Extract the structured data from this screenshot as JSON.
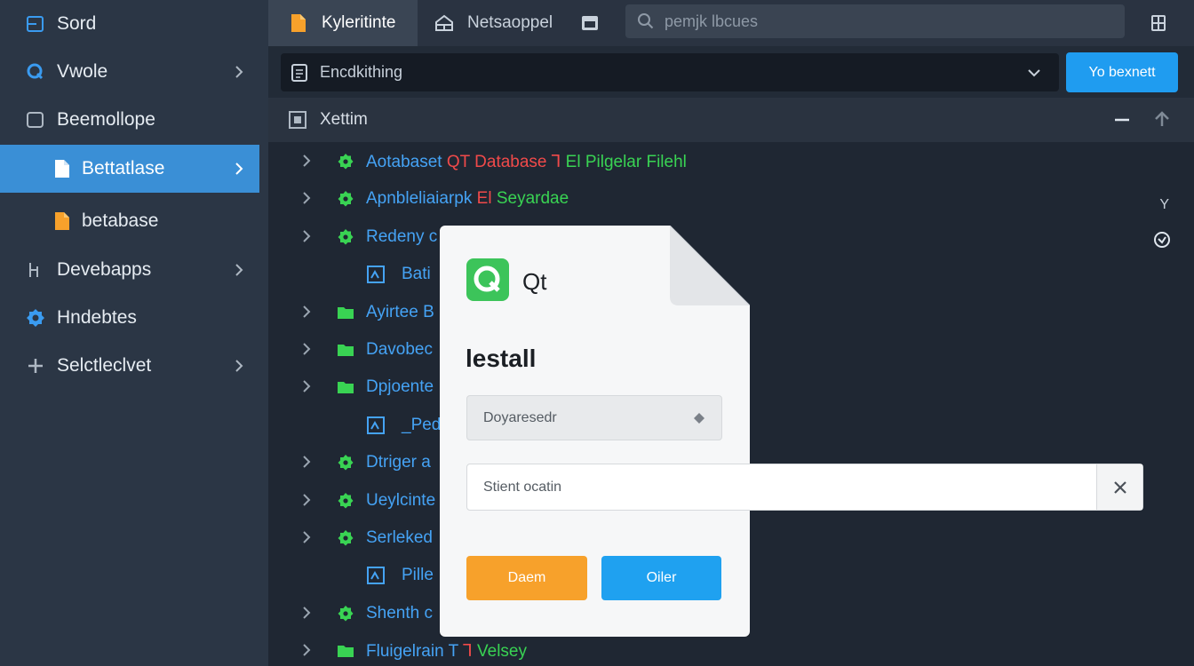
{
  "sidebar": {
    "items": [
      {
        "label": "Sord",
        "icon": "folder-outline-icon"
      },
      {
        "label": "Vwole",
        "icon": "q-icon"
      },
      {
        "label": "Beemollope",
        "icon": "square-outline-icon"
      },
      {
        "label": "Bettatlase",
        "icon": "file-icon"
      },
      {
        "label": "betabase",
        "icon": "orange-file-icon"
      },
      {
        "label": "Devebapps",
        "icon": "h-icon"
      },
      {
        "label": "Hndebtes",
        "icon": "gear-icon"
      },
      {
        "label": "Selctleclvet",
        "icon": "plus-icon"
      }
    ]
  },
  "topbar": {
    "tabs": [
      {
        "label": "Kyleritinte",
        "icon": "orange-file-icon"
      },
      {
        "label": "Netsaoppel",
        "icon": "home-icon"
      }
    ],
    "search_placeholder": "pemjk lbcues"
  },
  "pathbar": {
    "value": "Encdkithing",
    "button_label": "Yo bexnett"
  },
  "section": {
    "label": "Xettim"
  },
  "tree": {
    "rows": [
      {
        "parts": [
          {
            "t": "Aotabaset ",
            "c": "blue"
          },
          {
            "t": "QT Database ⅂ ",
            "c": "red"
          },
          {
            "t": "El Pilgelar Filehl",
            "c": "green"
          }
        ],
        "icon": "green-gear-icon",
        "leaf": false
      },
      {
        "parts": [
          {
            "t": "Apnbleliaiarpk ",
            "c": "blue"
          },
          {
            "t": "El ",
            "c": "red"
          },
          {
            "t": "Seyardae",
            "c": "green"
          }
        ],
        "icon": "green-gear-icon",
        "leaf": false
      },
      {
        "parts": [
          {
            "t": "Redeny c",
            "c": "blue"
          }
        ],
        "icon": "green-gear-icon",
        "leaf": false
      },
      {
        "parts": [
          {
            "t": "Bati",
            "c": "blue"
          }
        ],
        "icon": "blue-box-icon",
        "leaf": true
      },
      {
        "parts": [
          {
            "t": "Ayirtee B",
            "c": "blue"
          }
        ],
        "icon": "green-folder-icon",
        "leaf": false
      },
      {
        "parts": [
          {
            "t": "Davobec",
            "c": "blue"
          }
        ],
        "icon": "green-folder-icon",
        "leaf": false
      },
      {
        "parts": [
          {
            "t": "Dpjoente",
            "c": "blue"
          }
        ],
        "icon": "green-folder-icon",
        "leaf": false
      },
      {
        "parts": [
          {
            "t": "_Pedi",
            "c": "blue"
          }
        ],
        "icon": "blue-box-icon",
        "leaf": true
      },
      {
        "parts": [
          {
            "t": "Dtriger a",
            "c": "blue"
          }
        ],
        "icon": "green-gear-icon",
        "leaf": false
      },
      {
        "parts": [
          {
            "t": "Ueylcinte",
            "c": "blue"
          }
        ],
        "icon": "green-gear-icon",
        "leaf": false
      },
      {
        "parts": [
          {
            "t": "Serleked",
            "c": "blue"
          }
        ],
        "icon": "green-gear-icon",
        "leaf": false
      },
      {
        "parts": [
          {
            "t": "Pille",
            "c": "blue"
          }
        ],
        "icon": "blue-box-icon",
        "leaf": true
      },
      {
        "parts": [
          {
            "t": "Shenth c",
            "c": "blue"
          }
        ],
        "icon": "green-gear-icon",
        "leaf": false
      },
      {
        "parts": [
          {
            "t": "Fluigelrain ",
            "c": "blue"
          },
          {
            "t": "T ",
            "c": "blue"
          },
          {
            "t": "⅂ ",
            "c": "red"
          },
          {
            "t": "Velsey",
            "c": "green"
          }
        ],
        "icon": "green-folder-icon",
        "leaf": false
      }
    ],
    "right_marks": [
      "Y"
    ]
  },
  "dialog": {
    "app_name": "Qt",
    "heading": "lestall",
    "field1_value": "Doyaresedr",
    "field2_value": "Stient ocatin",
    "primary_label": "Daem",
    "secondary_label": "Oiler"
  },
  "colors": {
    "accent": "#3a8fd6",
    "blue_button": "#1f9cf0",
    "orange_button": "#f7a12b",
    "tree_blue": "#45a3f5",
    "tree_green": "#39d353",
    "tree_red": "#f04a4a"
  }
}
